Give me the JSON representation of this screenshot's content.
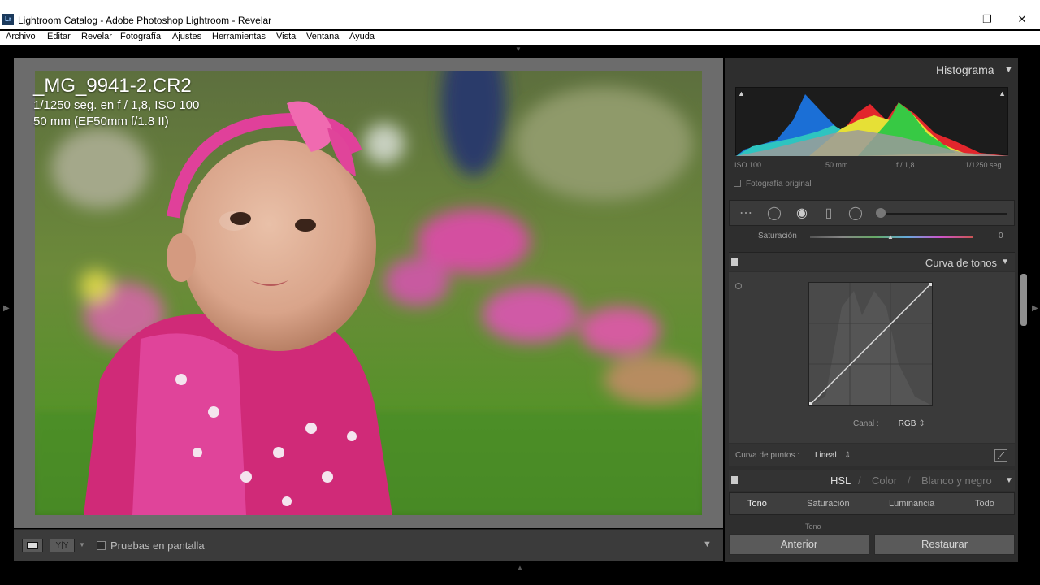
{
  "window": {
    "title": "Lightroom Catalog - Adobe Photoshop Lightroom - Revelar",
    "logo_text": "Lr",
    "minimize": "—",
    "restore": "❐",
    "close": "✕"
  },
  "menu": [
    "Archivo",
    "Editar",
    "Revelar",
    "Fotografía",
    "Ajustes",
    "Herramientas",
    "Vista",
    "Ventana",
    "Ayuda"
  ],
  "photo": {
    "filename": "_MG_9941-2.CR2",
    "exposure": "1/1250 seg. en f / 1,8, ISO 100",
    "lens": "50 mm (EF50mm f/1.8 II)"
  },
  "toolbar": {
    "soft_proofing_label": "Pruebas en pantalla"
  },
  "histogram": {
    "title": "Histograma",
    "iso": "ISO 100",
    "focal": "50 mm",
    "aperture": "f / 1,8",
    "shutter": "1/1250 seg.",
    "original_photo_label": "Fotografía original"
  },
  "saturation": {
    "label": "Saturación",
    "value": "0"
  },
  "tone_curve": {
    "title": "Curva de tonos",
    "channel_label": "Canal :",
    "channel_value": "RGB",
    "point_curve_label": "Curva de puntos :",
    "point_curve_value": "Lineal"
  },
  "hsl": {
    "hsl_label": "HSL",
    "color_label": "Color",
    "bw_label": "Blanco y negro",
    "separator": "/",
    "tabs": [
      "Tono",
      "Saturación",
      "Luminancia",
      "Todo"
    ],
    "sub_label": "Tono"
  },
  "buttons": {
    "previous": "Anterior",
    "reset": "Restaurar"
  },
  "colors": {
    "accent": "#1b3a5c",
    "panel_bg": "#2e2e2e",
    "center_bg": "#6c6c6c"
  }
}
